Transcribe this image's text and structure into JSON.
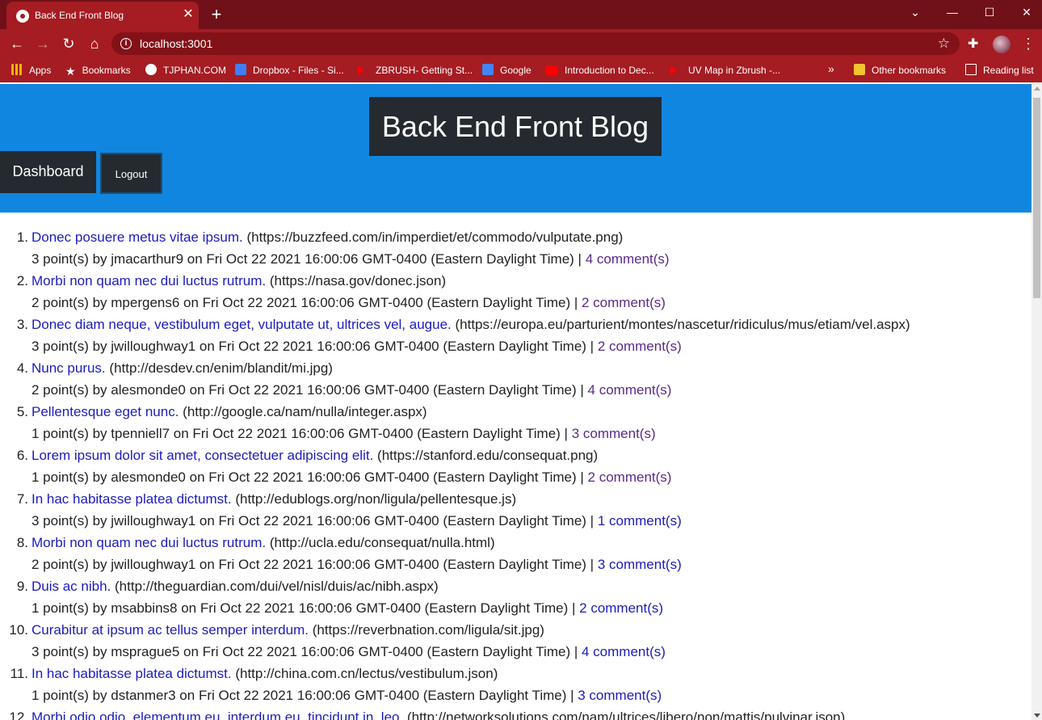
{
  "browser": {
    "tab_title": "Back End Front Blog",
    "url": "localhost:3001",
    "bookmarks": [
      {
        "label": "Apps",
        "icon": "apps-grid-icon",
        "color": "#f4b400"
      },
      {
        "label": "Bookmarks",
        "icon": "star-icon",
        "color": "#ffffff"
      },
      {
        "label": "TJPHAN.COM",
        "icon": "globe-icon",
        "color": "#ffffff"
      },
      {
        "label": "Dropbox - Files - Si...",
        "icon": "dropbox-icon",
        "color": "#3d7ff3"
      },
      {
        "label": "ZBRUSH- Getting St...",
        "icon": "play-icon",
        "color": "#ff0000"
      },
      {
        "label": "Google",
        "icon": "google-icon",
        "color": "#4285f4"
      },
      {
        "label": "Introduction to Dec...",
        "icon": "youtube-icon",
        "color": "#ff0000"
      },
      {
        "label": "UV Map in Zbrush -...",
        "icon": "play-icon",
        "color": "#ff0000"
      }
    ],
    "overflow": "»",
    "other_bookmarks": "Other bookmarks",
    "reading_list": "Reading list"
  },
  "header": {
    "site_title": "Back End Front Blog",
    "dashboard_label": "Dashboard",
    "logout_label": "Logout"
  },
  "posts": [
    {
      "num": "1.",
      "title": "Donec posuere metus vitae ipsum.",
      "url": "(https://buzzfeed.com/in/imperdiet/et/commodo/vulputate.png)",
      "meta": "3 point(s) by jmacarthur9 on Fri Oct 22 2021 16:00:06 GMT-0400 (Eastern Daylight Time) |",
      "comments": "4 comment(s)",
      "visited": true
    },
    {
      "num": "2.",
      "title": "Morbi non quam nec dui luctus rutrum.",
      "url": "(https://nasa.gov/donec.json)",
      "meta": "2 point(s) by mpergens6 on Fri Oct 22 2021 16:00:06 GMT-0400 (Eastern Daylight Time) |",
      "comments": "2 comment(s)",
      "visited": true
    },
    {
      "num": "3.",
      "title": "Donec diam neque, vestibulum eget, vulputate ut, ultrices vel, augue.",
      "url": "(https://europa.eu/parturient/montes/nascetur/ridiculus/mus/etiam/vel.aspx)",
      "meta": "3 point(s) by jwilloughway1 on Fri Oct 22 2021 16:00:06 GMT-0400 (Eastern Daylight Time) |",
      "comments": "2 comment(s)",
      "visited": true
    },
    {
      "num": "4.",
      "title": "Nunc purus.",
      "url": "(http://desdev.cn/enim/blandit/mi.jpg)",
      "meta": "2 point(s) by alesmonde0 on Fri Oct 22 2021 16:00:06 GMT-0400 (Eastern Daylight Time) |",
      "comments": "4 comment(s)",
      "visited": true
    },
    {
      "num": "5.",
      "title": "Pellentesque eget nunc.",
      "url": "(http://google.ca/nam/nulla/integer.aspx)",
      "meta": "1 point(s) by tpenniell7 on Fri Oct 22 2021 16:00:06 GMT-0400 (Eastern Daylight Time) |",
      "comments": "3 comment(s)",
      "visited": true
    },
    {
      "num": "6.",
      "title": "Lorem ipsum dolor sit amet, consectetuer adipiscing elit.",
      "url": "(https://stanford.edu/consequat.png)",
      "meta": "1 point(s) by alesmonde0 on Fri Oct 22 2021 16:00:06 GMT-0400 (Eastern Daylight Time) |",
      "comments": "2 comment(s)",
      "visited": true
    },
    {
      "num": "7.",
      "title": "In hac habitasse platea dictumst.",
      "url": "(http://edublogs.org/non/ligula/pellentesque.js)",
      "meta": "3 point(s) by jwilloughway1 on Fri Oct 22 2021 16:00:06 GMT-0400 (Eastern Daylight Time) |",
      "comments": "1 comment(s)",
      "visited": false
    },
    {
      "num": "8.",
      "title": "Morbi non quam nec dui luctus rutrum.",
      "url": "(http://ucla.edu/consequat/nulla.html)",
      "meta": "2 point(s) by jwilloughway1 on Fri Oct 22 2021 16:00:06 GMT-0400 (Eastern Daylight Time) |",
      "comments": "3 comment(s)",
      "visited": false
    },
    {
      "num": "9.",
      "title": "Duis ac nibh.",
      "url": "(http://theguardian.com/dui/vel/nisl/duis/ac/nibh.aspx)",
      "meta": "1 point(s) by msabbins8 on Fri Oct 22 2021 16:00:06 GMT-0400 (Eastern Daylight Time) |",
      "comments": "2 comment(s)",
      "visited": false
    },
    {
      "num": "10.",
      "title": "Curabitur at ipsum ac tellus semper interdum.",
      "url": "(https://reverbnation.com/ligula/sit.jpg)",
      "meta": "3 point(s) by msprague5 on Fri Oct 22 2021 16:00:06 GMT-0400 (Eastern Daylight Time) |",
      "comments": "4 comment(s)",
      "visited": false
    },
    {
      "num": "11.",
      "title": "In hac habitasse platea dictumst.",
      "url": "(http://china.com.cn/lectus/vestibulum.json)",
      "meta": "1 point(s) by dstanmer3 on Fri Oct 22 2021 16:00:06 GMT-0400 (Eastern Daylight Time) |",
      "comments": "3 comment(s)",
      "visited": false
    },
    {
      "num": "12.",
      "title": "Morbi odio odio, elementum eu, interdum eu, tincidunt in, leo.",
      "url": "(http://networksolutions.com/nam/ultrices/libero/non/mattis/pulvinar.json)",
      "meta": "",
      "comments": "",
      "visited": false
    }
  ]
}
